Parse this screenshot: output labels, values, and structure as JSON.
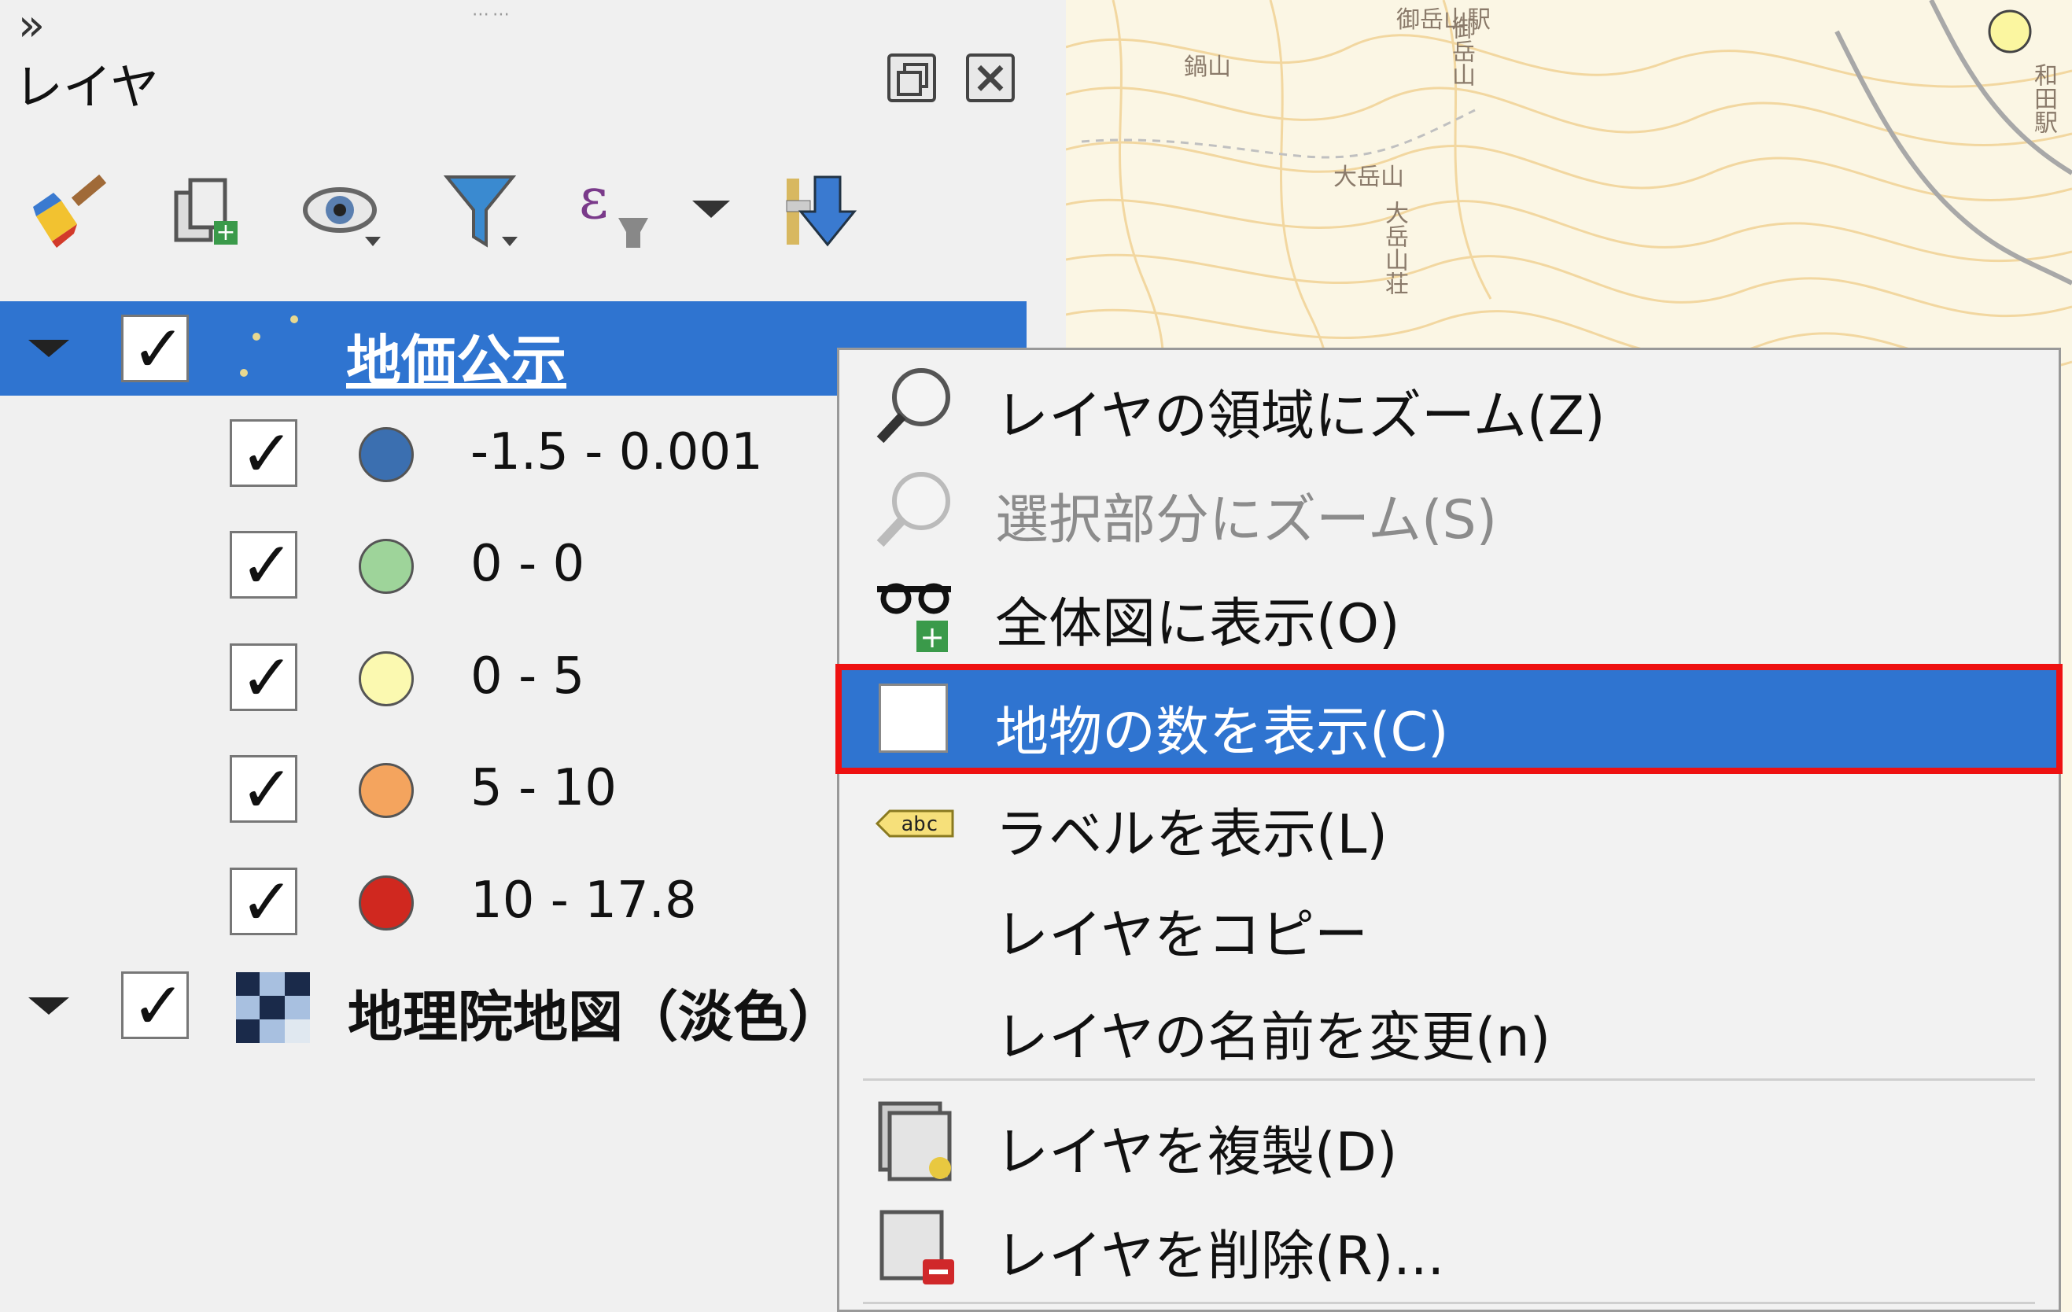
{
  "panel": {
    "title": "レイヤ",
    "toolbar_more": "»"
  },
  "layers": [
    {
      "name": "地価公示",
      "checked": true,
      "selected": true,
      "classes": [
        {
          "label": "-1.5 - 0.001",
          "color": "#3b6fb0",
          "checked": true
        },
        {
          "label": "0 - 0",
          "color": "#9ed49a",
          "checked": true
        },
        {
          "label": "0 - 5",
          "color": "#fbf9b0",
          "checked": true
        },
        {
          "label": "5 - 10",
          "color": "#f4a45e",
          "checked": true
        },
        {
          "label": "10 - 17.8",
          "color": "#d0281f",
          "checked": true
        }
      ]
    },
    {
      "name": "地理院地図（淡色）",
      "checked": true,
      "selected": false
    }
  ],
  "map": {
    "labels": [
      "御岳山駅",
      "鍋山",
      "大岳山",
      "大岳山荘",
      "御岳山",
      "和田駅"
    ]
  },
  "context_menu": {
    "items": [
      {
        "label": "レイヤの領域にズーム(Z)",
        "icon": "zoom-to-layer-icon",
        "enabled": true
      },
      {
        "label": "選択部分にズーム(S)",
        "icon": "zoom-to-selection-icon",
        "enabled": false
      },
      {
        "label": "全体図に表示(O)",
        "icon": "show-in-overview-icon",
        "enabled": true
      },
      {
        "label": "地物の数を表示(C)",
        "icon": "checkbox-icon",
        "enabled": true,
        "highlighted": true
      },
      {
        "label": "ラベルを表示(L)",
        "icon": "label-abc-icon",
        "enabled": true
      },
      {
        "label": "レイヤをコピー",
        "icon": "",
        "enabled": true
      },
      {
        "label": "レイヤの名前を変更(n)",
        "icon": "",
        "enabled": true
      },
      {
        "label": "レイヤを複製(D)",
        "icon": "duplicate-layer-icon",
        "enabled": true
      },
      {
        "label": "レイヤを削除(R)...",
        "icon": "remove-layer-icon",
        "enabled": true
      }
    ]
  },
  "colors": {
    "selection": "#2f74d0",
    "highlight_border": "#e11111"
  }
}
